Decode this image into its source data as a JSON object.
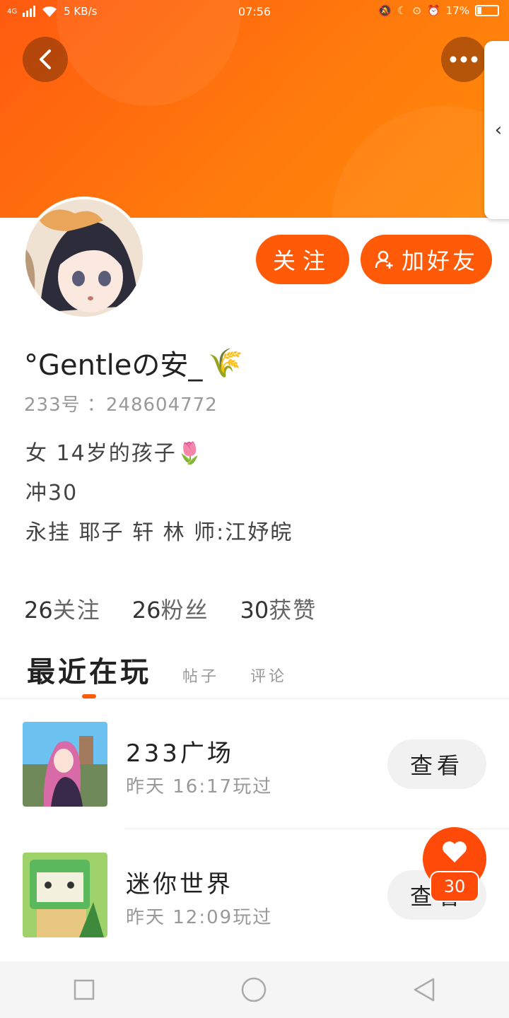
{
  "status": {
    "network": "4G",
    "speed": "5 KB/s",
    "time": "07:56",
    "battery": "17%"
  },
  "profile": {
    "follow_label": "关注",
    "add_friend_label": "加好友",
    "name": "°Gentleの安_",
    "uid": "233号 ：248604772",
    "bio": [
      "女 14岁的孩子🌷",
      "冲30",
      "永挂 耶子 轩 林 师:江妤皖"
    ],
    "stats": [
      {
        "count": "26",
        "label": "关注"
      },
      {
        "count": "26",
        "label": "粉丝"
      },
      {
        "count": "30",
        "label": "获赞"
      }
    ]
  },
  "tabs": [
    "最近在玩",
    "帖子",
    "评论"
  ],
  "games": [
    {
      "name": "233广场",
      "time": "昨天 16:17玩过",
      "button": "查看"
    },
    {
      "name": "迷你世界",
      "time": "昨天 12:09玩过",
      "button": "查看"
    }
  ],
  "likes": "30",
  "colors": {
    "accent": "#ff5a08",
    "header": "#ff7a0c"
  }
}
